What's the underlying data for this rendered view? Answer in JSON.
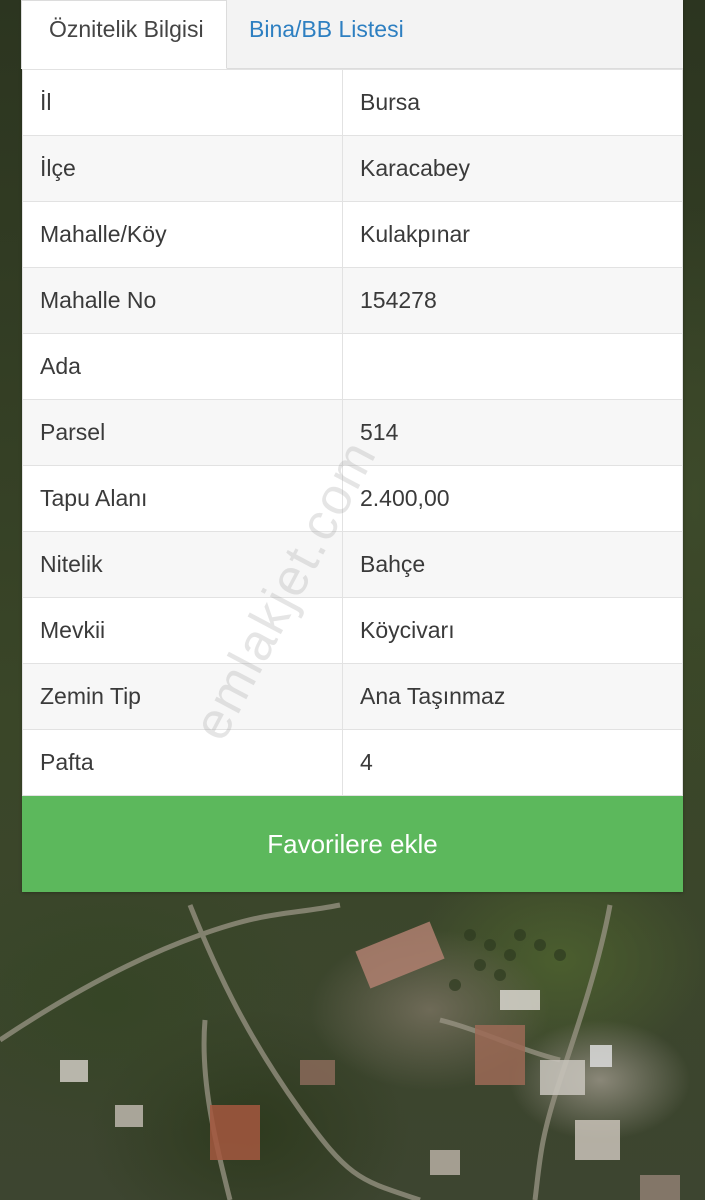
{
  "tabs": [
    {
      "label": "Öznitelik Bilgisi",
      "active": true
    },
    {
      "label": "Bina/BB Listesi",
      "active": false
    }
  ],
  "attributes": [
    {
      "key": "İl",
      "value": "Bursa"
    },
    {
      "key": "İlçe",
      "value": "Karacabey"
    },
    {
      "key": "Mahalle/Köy",
      "value": "Kulakpınar"
    },
    {
      "key": "Mahalle No",
      "value": "154278"
    },
    {
      "key": "Ada",
      "value": ""
    },
    {
      "key": "Parsel",
      "value": "514"
    },
    {
      "key": "Tapu Alanı",
      "value": "2.400,00"
    },
    {
      "key": "Nitelik",
      "value": "Bahçe"
    },
    {
      "key": "Mevkii",
      "value": "Köycivarı"
    },
    {
      "key": "Zemin Tip",
      "value": "Ana Taşınmaz"
    },
    {
      "key": "Pafta",
      "value": "4"
    }
  ],
  "favorite_button": "Favorilere ekle",
  "watermark": "emlakjet.com",
  "colors": {
    "accent_green": "#5cb85c",
    "link_blue": "#2d7fc1"
  }
}
